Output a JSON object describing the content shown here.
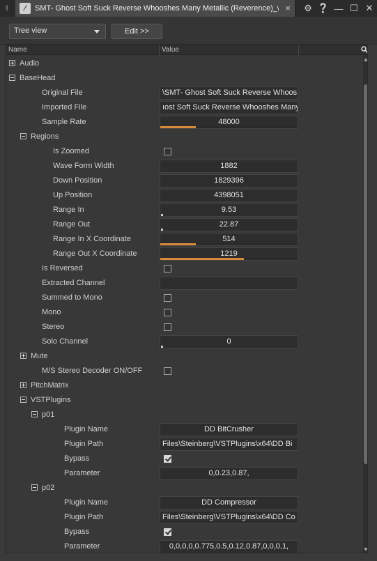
{
  "window": {
    "tab_title": "SMT- Ghost Soft Suck Reverse Whooshes Many Metallic (Reverence)_wa...",
    "close_glyph": "×"
  },
  "toolbar": {
    "view_select": "Tree view",
    "edit_button": "Edit >>"
  },
  "tree": {
    "col_name": "Name",
    "col_value": "Value",
    "rows": [
      {
        "label": "Audio",
        "level": 0,
        "expander": "plus"
      },
      {
        "label": "BaseHead",
        "level": 0,
        "expander": "minus"
      },
      {
        "label": "Original File",
        "level": 1,
        "value": "\\SMT- Ghost Soft Suck Reverse Whoos",
        "align": "left"
      },
      {
        "label": "Imported File",
        "level": 1,
        "value": "ıost Soft Suck Reverse Whooshes Many",
        "align": "left"
      },
      {
        "label": "Sample Rate",
        "level": 1,
        "value": "48000",
        "progress": 0.26
      },
      {
        "label": "Regions",
        "level": 1,
        "expander": "minus"
      },
      {
        "label": "Is Zoomed",
        "level": 2,
        "checkbox": false
      },
      {
        "label": "Wave Form Width",
        "level": 2,
        "value": "1882"
      },
      {
        "label": "Down Position",
        "level": 2,
        "value": "1829396"
      },
      {
        "label": "Up Position",
        "level": 2,
        "value": "4398051"
      },
      {
        "label": "Range In",
        "level": 2,
        "value": "9.53",
        "dot": true
      },
      {
        "label": "Range Out",
        "level": 2,
        "value": "22.87",
        "dot": true
      },
      {
        "label": "Range In X Coordinate",
        "level": 2,
        "value": "514",
        "progress": 0.26
      },
      {
        "label": "Range Out X Coordinate",
        "level": 2,
        "value": "1219",
        "progress": 0.61
      },
      {
        "label": "Is Reversed",
        "level": 1,
        "checkbox": false
      },
      {
        "label": "Extracted Channel",
        "level": 1,
        "value": ""
      },
      {
        "label": "Summed to Mono",
        "level": 1,
        "checkbox": false
      },
      {
        "label": "Mono",
        "level": 1,
        "checkbox": false
      },
      {
        "label": "Stereo",
        "level": 1,
        "checkbox": false
      },
      {
        "label": "Solo Channel",
        "level": 1,
        "value": "0",
        "dot": true
      },
      {
        "label": "Mute",
        "level": 1,
        "expander": "plus"
      },
      {
        "label": "M/S Stereo Decoder ON/OFF",
        "level": 1,
        "checkbox": false
      },
      {
        "label": "PitchMatrix",
        "level": 1,
        "expander": "plus"
      },
      {
        "label": "VSTPlugins",
        "level": 1,
        "expander": "minus"
      },
      {
        "label": "p01",
        "level": 2,
        "expander": "minus"
      },
      {
        "label": "Plugin Name",
        "level": 3,
        "value": "DD BitCrusher"
      },
      {
        "label": "Plugin Path",
        "level": 3,
        "value": "Files\\Steinberg\\VSTPlugins\\x64\\DD Bi",
        "align": "left"
      },
      {
        "label": "Bypass",
        "level": 3,
        "checkbox": true
      },
      {
        "label": "Parameter",
        "level": 3,
        "value": "0,0.23,0.87,"
      },
      {
        "label": "p02",
        "level": 2,
        "expander": "minus"
      },
      {
        "label": "Plugin Name",
        "level": 3,
        "value": "DD Compressor"
      },
      {
        "label": "Plugin Path",
        "level": 3,
        "value": "Files\\Steinberg\\VSTPlugins\\x64\\DD Co",
        "align": "left"
      },
      {
        "label": "Bypass",
        "level": 3,
        "checkbox": true
      },
      {
        "label": "Parameter",
        "level": 3,
        "value": "0,0,0,0,0.775,0.5,0.12,0.87,0,0,0,1,"
      }
    ]
  },
  "colors": {
    "accent": "#d68a3a",
    "background": "#383838"
  },
  "icons": {
    "settings": "gear-icon",
    "help": "help-icon",
    "minimize": "minimize-icon",
    "maximize": "maximize-icon",
    "close": "close-icon",
    "search": "search-icon"
  }
}
